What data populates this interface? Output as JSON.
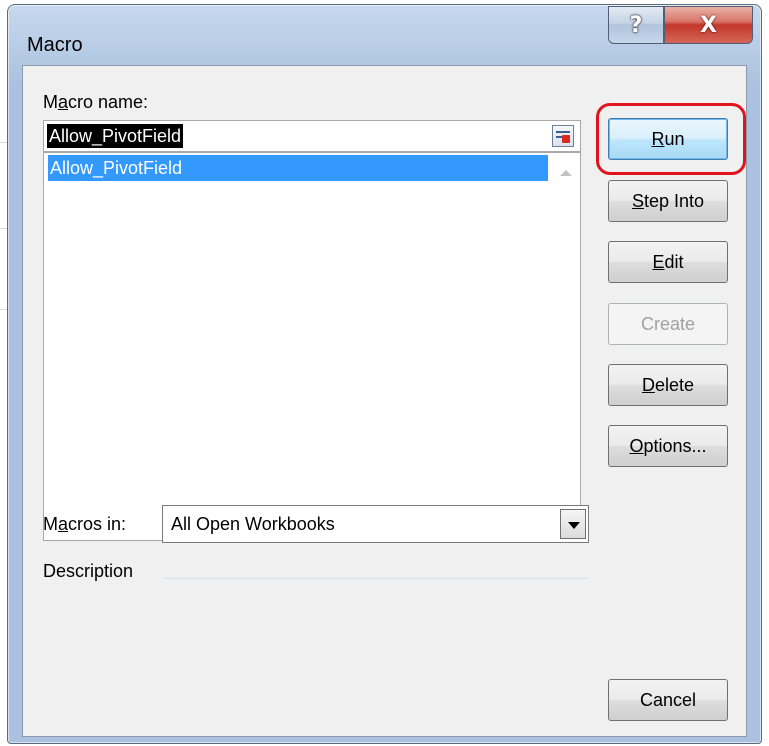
{
  "window": {
    "title": "Macro",
    "help_glyph": "?",
    "close_glyph": "X"
  },
  "macro_name": {
    "label_prefix": "M",
    "label_accel": "a",
    "label_rest": "cro name:",
    "value": "Allow_PivotField"
  },
  "macro_list": {
    "items": [
      "Allow_PivotField"
    ],
    "selected_index": 0
  },
  "buttons": {
    "run": {
      "accel": "R",
      "rest": "un"
    },
    "step_into": {
      "accel": "S",
      "rest": "tep Into"
    },
    "edit": {
      "accel": "E",
      "rest": "dit"
    },
    "create": {
      "label": "Create",
      "enabled": false
    },
    "delete": {
      "accel": "D",
      "rest": "elete"
    },
    "options": {
      "accel": "O",
      "rest": "ptions..."
    },
    "cancel": {
      "label": "Cancel"
    }
  },
  "macros_in": {
    "label_prefix": "M",
    "label_accel": "a",
    "label_rest": "cros in:",
    "value": "All Open Workbooks"
  },
  "description": {
    "label": "Description"
  },
  "colors": {
    "selection": "#3399ff",
    "highlight_ring": "#e0141e"
  },
  "icons": {
    "help": "help-icon",
    "close": "close-icon",
    "picker": "range-picker-icon",
    "dropdown": "chevron-down-icon"
  }
}
